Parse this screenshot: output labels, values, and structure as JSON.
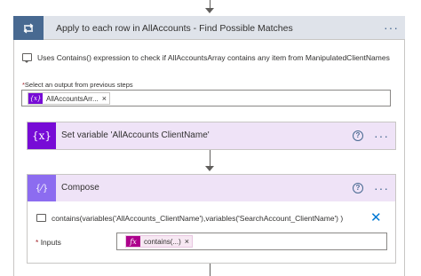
{
  "loop": {
    "title": "Apply to each row in AllAccounts - Find Possible Matches",
    "icon": "loop-icon",
    "more": "···",
    "comment": "Uses Contains() expression to check if AllAccountsArray contains any item from ManipulatedClientNames",
    "select_label": "Select an output from previous steps",
    "required_mark": "*",
    "select_token": {
      "icon": "{x}",
      "label": "AllAccountsArr...",
      "remove": "×"
    }
  },
  "set_variable": {
    "title": "Set variable 'AllAccounts ClientName'",
    "icon": "{x}",
    "help": "?",
    "more": "···"
  },
  "compose": {
    "title": "Compose",
    "icon": "{⁄}",
    "help": "?",
    "more": "···",
    "comment": "contains(variables('AllAccounts_ClientName'),variables('SearchAccount_ClientName') )",
    "close": "✕",
    "required_mark": "*",
    "inputs_label": "Inputs",
    "inputs_token": {
      "icon": "fx",
      "label": "contains(...)",
      "remove": "×"
    }
  },
  "colors": {
    "loop_header": "#dfe3ea",
    "loop_icon": "#486991",
    "variable_purple": "#770bd6",
    "compose_purple": "#8c6cf0",
    "card_header": "#efe3f7",
    "expression_magenta": "#ad008c",
    "link_blue": "#0078d4"
  }
}
